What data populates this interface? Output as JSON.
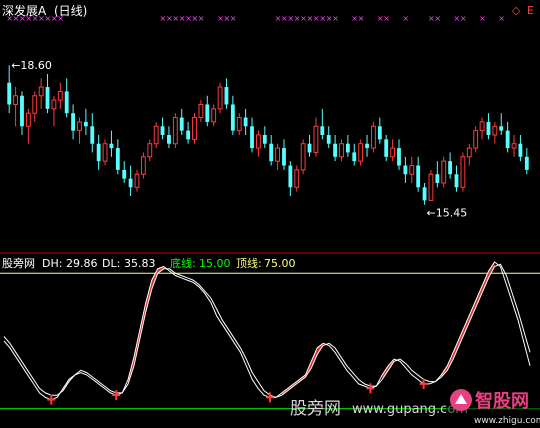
{
  "header": {
    "stock_name": "深发展A",
    "period": "(日线)",
    "menu_glyph": "◇",
    "menu_letter": "E"
  },
  "indicator": {
    "name": "股旁网",
    "dh_label": "DH:",
    "dh_value": "29.86",
    "dl_label": "DL:",
    "dl_value": "35.83",
    "bottom_label": "底线:",
    "bottom_value": "15.00",
    "top_label": "顶线:",
    "top_value": "75.00"
  },
  "watermarks": {
    "site_cn": "股旁网",
    "site_url": "www.gupang.com",
    "logo_text": "智股网",
    "logo_url": "www.zhigu.com"
  },
  "colors": {
    "up": "#ff3c3c",
    "down": "#54ffff",
    "signal": "#ff40ff",
    "line_top": "#ffff80",
    "line_bottom": "#00ff00",
    "panel_divider": "#c00000",
    "oscillator": "#ffffff"
  },
  "chart_data": [
    {
      "type": "candlestick",
      "title": "深发展A (日线)",
      "ylim": [
        14.5,
        19.5
      ],
      "annotations": [
        {
          "label": "18.60",
          "y": 18.6,
          "type": "max"
        },
        {
          "label": "15.45",
          "y": 15.45,
          "type": "min"
        }
      ],
      "ohlc": [
        [
          18.2,
          18.6,
          17.5,
          17.7
        ],
        [
          17.7,
          18.1,
          17.2,
          17.9
        ],
        [
          17.9,
          18.0,
          17.0,
          17.2
        ],
        [
          17.2,
          17.6,
          16.8,
          17.5
        ],
        [
          17.5,
          18.0,
          17.3,
          17.9
        ],
        [
          17.9,
          18.3,
          17.6,
          18.1
        ],
        [
          18.1,
          18.4,
          17.5,
          17.6
        ],
        [
          17.6,
          17.9,
          17.2,
          17.8
        ],
        [
          17.8,
          18.2,
          17.6,
          18.0
        ],
        [
          18.0,
          18.3,
          17.4,
          17.5
        ],
        [
          17.5,
          17.7,
          16.9,
          17.1
        ],
        [
          17.1,
          17.4,
          16.8,
          17.3
        ],
        [
          17.3,
          17.6,
          17.0,
          17.2
        ],
        [
          17.2,
          17.5,
          16.6,
          16.8
        ],
        [
          16.8,
          17.0,
          16.2,
          16.4
        ],
        [
          16.4,
          16.9,
          16.3,
          16.8
        ],
        [
          16.8,
          17.1,
          16.5,
          16.7
        ],
        [
          16.7,
          16.9,
          16.1,
          16.2
        ],
        [
          16.2,
          16.4,
          15.9,
          16.0
        ],
        [
          16.0,
          16.3,
          15.6,
          15.8
        ],
        [
          15.8,
          16.2,
          15.7,
          16.1
        ],
        [
          16.1,
          16.6,
          16.0,
          16.5
        ],
        [
          16.5,
          16.9,
          16.4,
          16.8
        ],
        [
          16.8,
          17.3,
          16.7,
          17.2
        ],
        [
          17.2,
          17.4,
          16.9,
          17.0
        ],
        [
          17.0,
          17.2,
          16.7,
          16.8
        ],
        [
          16.8,
          17.5,
          16.7,
          17.4
        ],
        [
          17.4,
          17.6,
          17.0,
          17.1
        ],
        [
          17.1,
          17.3,
          16.8,
          16.9
        ],
        [
          16.9,
          17.5,
          16.8,
          17.4
        ],
        [
          17.4,
          17.8,
          17.3,
          17.7
        ],
        [
          17.7,
          17.9,
          17.2,
          17.3
        ],
        [
          17.3,
          17.7,
          17.2,
          17.6
        ],
        [
          17.6,
          18.2,
          17.5,
          18.1
        ],
        [
          18.1,
          18.3,
          17.6,
          17.7
        ],
        [
          17.7,
          17.9,
          17.0,
          17.1
        ],
        [
          17.1,
          17.5,
          17.0,
          17.4
        ],
        [
          17.4,
          17.6,
          17.0,
          17.2
        ],
        [
          17.2,
          17.4,
          16.6,
          16.7
        ],
        [
          16.7,
          17.1,
          16.5,
          17.0
        ],
        [
          17.0,
          17.2,
          16.7,
          16.8
        ],
        [
          16.8,
          17.0,
          16.3,
          16.4
        ],
        [
          16.4,
          16.8,
          16.2,
          16.7
        ],
        [
          16.7,
          16.9,
          16.2,
          16.3
        ],
        [
          16.3,
          16.4,
          15.6,
          15.8
        ],
        [
          15.8,
          16.3,
          15.7,
          16.2
        ],
        [
          16.2,
          16.9,
          16.1,
          16.8
        ],
        [
          16.8,
          17.0,
          16.5,
          16.6
        ],
        [
          16.6,
          17.4,
          16.5,
          17.2
        ],
        [
          17.2,
          17.6,
          16.9,
          17.0
        ],
        [
          17.0,
          17.2,
          16.7,
          16.8
        ],
        [
          16.8,
          17.0,
          16.4,
          16.5
        ],
        [
          16.5,
          16.9,
          16.4,
          16.8
        ],
        [
          16.8,
          17.0,
          16.5,
          16.6
        ],
        [
          16.6,
          16.8,
          16.3,
          16.4
        ],
        [
          16.4,
          16.9,
          16.3,
          16.8
        ],
        [
          16.8,
          17.0,
          16.5,
          16.7
        ],
        [
          16.7,
          17.3,
          16.6,
          17.2
        ],
        [
          17.2,
          17.4,
          16.8,
          16.9
        ],
        [
          16.9,
          17.0,
          16.4,
          16.5
        ],
        [
          16.5,
          16.9,
          16.4,
          16.7
        ],
        [
          16.7,
          16.9,
          16.2,
          16.3
        ],
        [
          16.3,
          16.5,
          15.9,
          16.1
        ],
        [
          16.1,
          16.5,
          15.9,
          16.3
        ],
        [
          16.3,
          16.5,
          15.7,
          15.8
        ],
        [
          15.8,
          15.9,
          15.4,
          15.5
        ],
        [
          15.5,
          16.2,
          15.5,
          16.1
        ],
        [
          16.1,
          16.4,
          15.8,
          15.9
        ],
        [
          15.9,
          16.5,
          15.8,
          16.4
        ],
        [
          16.4,
          16.6,
          16.0,
          16.1
        ],
        [
          16.1,
          16.3,
          15.7,
          15.8
        ],
        [
          15.8,
          16.6,
          15.7,
          16.5
        ],
        [
          16.5,
          16.8,
          16.3,
          16.7
        ],
        [
          16.7,
          17.2,
          16.6,
          17.1
        ],
        [
          17.1,
          17.4,
          16.9,
          17.3
        ],
        [
          17.3,
          17.5,
          16.9,
          17.0
        ],
        [
          17.0,
          17.3,
          16.8,
          17.2
        ],
        [
          17.2,
          17.5,
          17.0,
          17.1
        ],
        [
          17.1,
          17.3,
          16.6,
          16.7
        ],
        [
          16.7,
          17.0,
          16.5,
          16.8
        ],
        [
          16.8,
          17.0,
          16.4,
          16.5
        ],
        [
          16.5,
          16.7,
          16.1,
          16.2
        ]
      ],
      "signal_marks": "×"
    },
    {
      "type": "line",
      "title": "股旁网",
      "ylim": [
        10,
        80
      ],
      "reference_lines": [
        {
          "name": "顶线",
          "y": 75
        },
        {
          "name": "底线",
          "y": 15
        }
      ],
      "series": [
        {
          "name": "DH",
          "values": [
            45,
            42,
            38,
            34,
            30,
            26,
            22,
            20,
            19,
            20,
            24,
            28,
            30,
            31,
            30,
            28,
            26,
            24,
            22,
            21,
            22,
            28,
            38,
            50,
            62,
            72,
            77,
            78,
            76,
            74,
            73,
            72,
            71,
            69,
            66,
            62,
            56,
            52,
            48,
            44,
            40,
            34,
            28,
            24,
            21,
            20,
            20,
            22,
            24,
            26,
            28,
            30,
            36,
            42,
            44,
            43,
            40,
            36,
            32,
            29,
            26,
            25,
            24,
            25,
            30,
            34,
            37,
            36,
            33,
            30,
            28,
            26,
            26,
            27,
            30,
            34,
            40,
            46,
            52,
            58,
            64,
            70,
            76,
            80,
            78,
            70,
            62,
            54,
            44,
            34
          ]
        },
        {
          "name": "DL",
          "values": [
            47,
            44,
            40,
            36,
            32,
            28,
            24,
            22,
            21,
            21,
            23,
            27,
            30,
            32,
            31,
            29,
            27,
            25,
            23,
            22,
            22,
            26,
            34,
            46,
            58,
            68,
            75,
            77,
            77,
            75,
            74,
            73,
            72,
            70,
            67,
            64,
            59,
            54,
            50,
            46,
            42,
            37,
            31,
            27,
            23,
            21,
            20,
            21,
            23,
            25,
            27,
            29,
            33,
            39,
            43,
            44,
            42,
            38,
            34,
            31,
            28,
            26,
            25,
            25,
            28,
            32,
            36,
            37,
            35,
            32,
            30,
            28,
            27,
            27,
            29,
            32,
            37,
            43,
            49,
            55,
            61,
            67,
            73,
            78,
            79,
            74,
            66,
            58,
            49,
            40
          ]
        }
      ]
    }
  ]
}
